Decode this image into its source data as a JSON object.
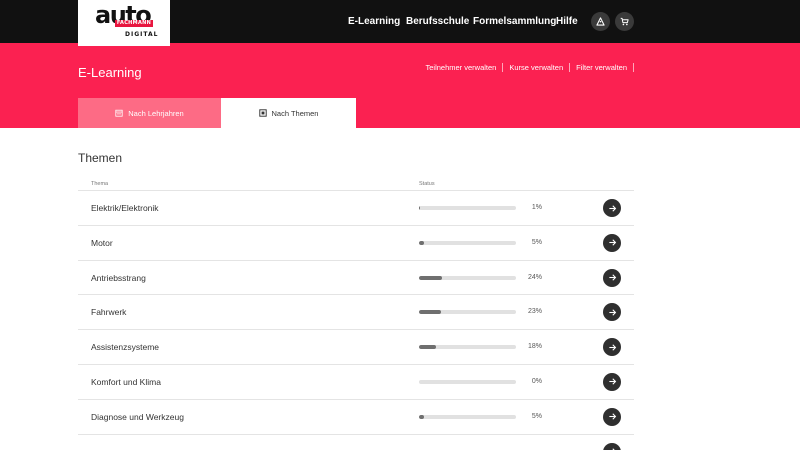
{
  "logo": {
    "main": "auto",
    "strip": "FACHMANN",
    "sub": "DIGITAL"
  },
  "nav": {
    "items": [
      "E-Learning",
      "Berufsschule",
      "Formelsammlung",
      "Hilfe"
    ],
    "icons": [
      "user-icon",
      "cart-icon"
    ]
  },
  "hero": {
    "title": "E-Learning",
    "links": [
      "Teilnehmer verwalten",
      "Kurse verwalten",
      "Filter verwalten"
    ],
    "tabs": [
      {
        "label": "Nach Lehrjahren",
        "icon": "calendar-icon",
        "active": false
      },
      {
        "label": "Nach Themen",
        "icon": "topics-icon",
        "active": true
      }
    ]
  },
  "section": {
    "title": "Themen",
    "columns": {
      "thema": "Thema",
      "status": "Status"
    },
    "rows": [
      {
        "name": "Elektrik/Elektronik",
        "percent": 1,
        "label": "1%"
      },
      {
        "name": "Motor",
        "percent": 5,
        "label": "5%"
      },
      {
        "name": "Antriebsstrang",
        "percent": 24,
        "label": "24%"
      },
      {
        "name": "Fahrwerk",
        "percent": 23,
        "label": "23%"
      },
      {
        "name": "Assistenzsysteme",
        "percent": 18,
        "label": "18%"
      },
      {
        "name": "Komfort und Klima",
        "percent": 0,
        "label": "0%"
      },
      {
        "name": "Diagnose und Werkzeug",
        "percent": 5,
        "label": "5%"
      },
      {
        "name": "",
        "percent": 0,
        "label": ""
      }
    ]
  },
  "colors": {
    "topbar": "#111111",
    "accent": "#fb2151",
    "tab_inactive": "#fd6b85",
    "progress_fill": "#6f6f6f",
    "progress_track": "#e1e1e1"
  }
}
